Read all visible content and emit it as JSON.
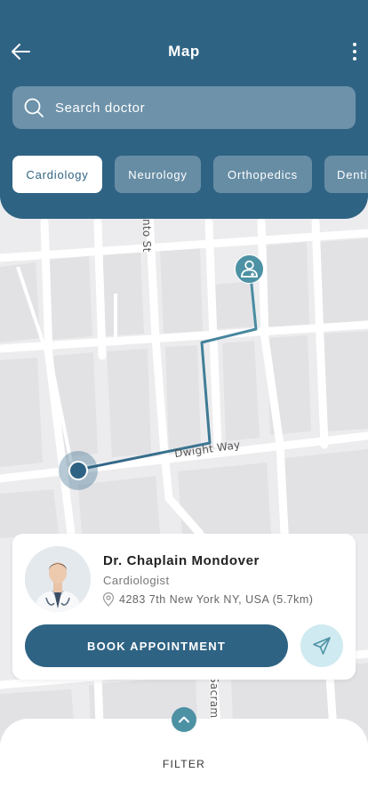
{
  "header": {
    "title": "Map",
    "back_icon": "arrow-left-icon",
    "more_icon": "more-vertical-icon",
    "bg_color": "#2f6384"
  },
  "search": {
    "placeholder": "Search doctor",
    "icon": "search-icon"
  },
  "categories": [
    {
      "label": "Cardiology",
      "active": true
    },
    {
      "label": "Neurology",
      "active": false
    },
    {
      "label": "Orthopedics",
      "active": false
    },
    {
      "label": "Denti",
      "active": false
    }
  ],
  "map": {
    "streets": [
      "nto St",
      "Dwight Way",
      "Sacram"
    ],
    "user_marker_icon": "location-dot-icon",
    "doctor_marker_icon": "doctor-icon"
  },
  "doctor": {
    "name": "Dr. Chaplain Mondover",
    "specialty": "Cardiologist",
    "address": "4283 7th New York NY, USA (5.7km)",
    "address_icon": "location-pin-icon",
    "book_label": "BOOK APPOINTMENT",
    "send_icon": "send-icon"
  },
  "sheet": {
    "handle_icon": "chevron-up-icon",
    "filter_label": "FILTER"
  }
}
